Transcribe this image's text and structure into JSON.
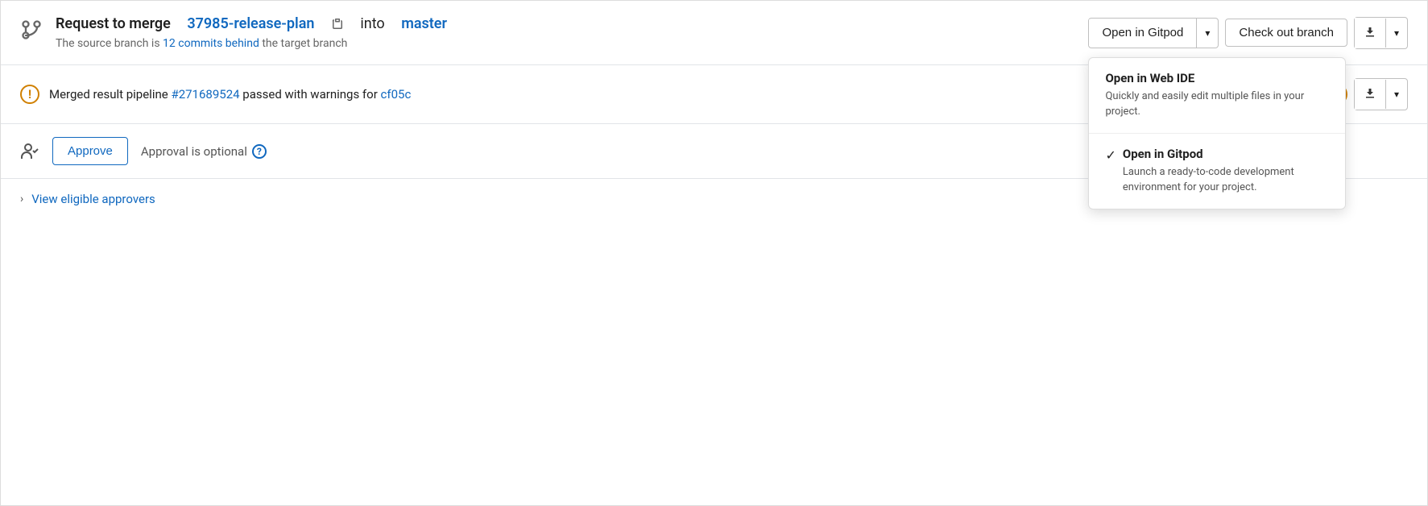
{
  "header": {
    "merge_label": "Request to merge",
    "branch_name": "37985-release-plan",
    "into_text": "into",
    "master_text": "master",
    "subtitle_prefix": "The source branch is",
    "commits_behind": "12 commits behind",
    "subtitle_suffix": "the target branch"
  },
  "actions": {
    "gitpod_label": "Open in Gitpod",
    "checkout_label": "Check out branch",
    "dropdown_arrow": "▾"
  },
  "dropdown": {
    "item1": {
      "title": "Open in Web IDE",
      "description": "Quickly and easily edit multiple files in your project."
    },
    "item2": {
      "title": "Open in Gitpod",
      "description": "Launch a ready-to-code development environment for your project.",
      "selected": true
    }
  },
  "pipeline": {
    "prefix": "Merged result pipeline",
    "pipeline_link": "#271689524",
    "middle": "passed with warnings for",
    "commit_hash": "cf05c",
    "warning_symbol": "!"
  },
  "approve": {
    "button_label": "Approve",
    "optional_text": "Approval is optional",
    "help_symbol": "?"
  },
  "approvers": {
    "chevron": "›",
    "link_text": "View eligible approvers"
  },
  "colors": {
    "blue": "#1068bf",
    "orange": "#d08000",
    "green": "#26a269",
    "border": "#bfbfbf",
    "text": "#1f1f1f",
    "muted": "#555"
  }
}
